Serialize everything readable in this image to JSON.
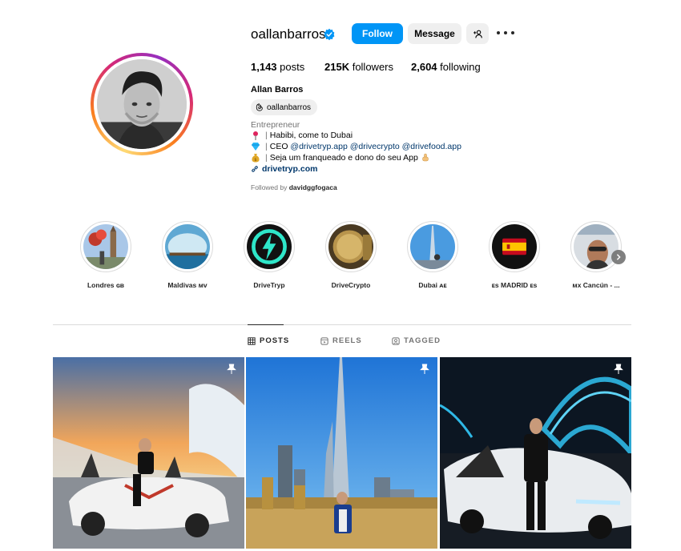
{
  "profile": {
    "username": "oallanbarros",
    "follow_label": "Follow",
    "message_label": "Message",
    "posts_count": "1,143",
    "posts_label": "posts",
    "followers_count": "215K",
    "followers_label": "followers",
    "following_count": "2,604",
    "following_label": "following",
    "full_name": "Allan Barros",
    "threads_handle": "oallanbarros",
    "category": "Entrepreneur",
    "bio": {
      "line1": "Habibi, come to Dubai",
      "line2_prefix": "CEO",
      "line2_mentions": [
        "@drivetryp.app",
        "@drivecrypto",
        "@drivefood.app"
      ],
      "line3": "Seja um franqueado e dono do seu App"
    },
    "link": "drivetryp.com",
    "followed_by_prefix": "Followed by",
    "followed_by_user": "davidggfogaca"
  },
  "highlights": [
    {
      "label": "Londres ɢʙ"
    },
    {
      "label": "Maldivas ᴍᴠ"
    },
    {
      "label": "DriveTryp"
    },
    {
      "label": "DriveCrypto"
    },
    {
      "label": "Dubai ᴀᴇ"
    },
    {
      "label": "ᴇs MADRID ᴇs"
    },
    {
      "label": "ᴍx Cancún - ..."
    }
  ],
  "tabs": {
    "posts": "POSTS",
    "reels": "REELS",
    "tagged": "TAGGED"
  },
  "colors": {
    "accent": "#0095f6",
    "secondary_button": "#efefef",
    "link": "#00376b",
    "muted": "#737373"
  },
  "icons": {
    "verified": "verified-badge-icon",
    "add_user": "add-user-icon",
    "more": "more-horizontal-icon",
    "threads": "threads-icon",
    "link": "link-icon",
    "pin": "pin-icon"
  }
}
